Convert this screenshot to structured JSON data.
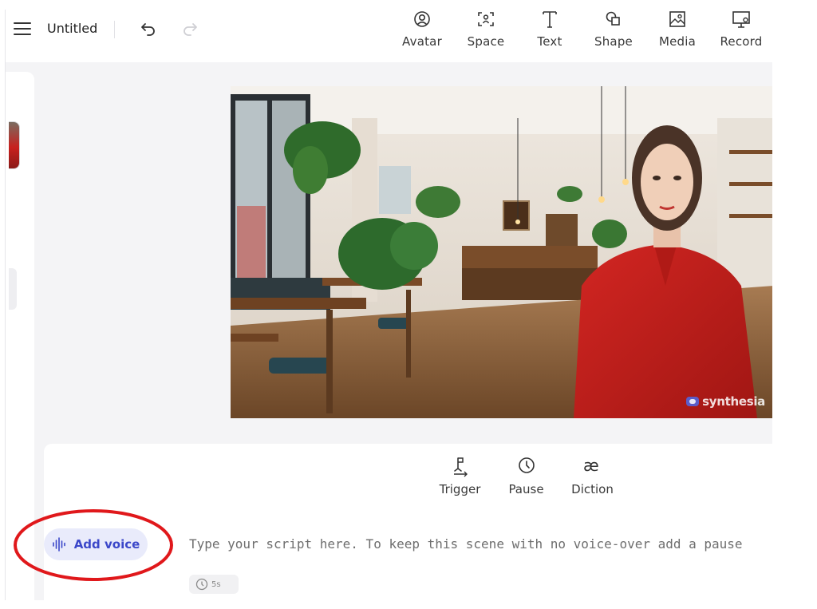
{
  "header": {
    "title": "Untitled"
  },
  "toolbar": {
    "items": [
      {
        "label": "Avatar",
        "icon": "avatar-icon"
      },
      {
        "label": "Space",
        "icon": "space-icon"
      },
      {
        "label": "Text",
        "icon": "text-icon"
      },
      {
        "label": "Shape",
        "icon": "shape-icon"
      },
      {
        "label": "Media",
        "icon": "media-icon"
      },
      {
        "label": "Record",
        "icon": "record-icon"
      }
    ]
  },
  "scene": {
    "watermark": "synthesia"
  },
  "script": {
    "tools": [
      {
        "label": "Trigger",
        "icon": "trigger-icon"
      },
      {
        "label": "Pause",
        "icon": "clock-icon"
      },
      {
        "label": "Diction",
        "icon": "diction-icon"
      }
    ],
    "add_voice_label": "Add voice",
    "placeholder": "Type your script here. To keep this scene with no voice-over add a pause",
    "duration": "5s"
  },
  "colors": {
    "accent": "#3b47c9",
    "accent_bg": "#e9ebfb",
    "annotation": "#e0181b"
  }
}
